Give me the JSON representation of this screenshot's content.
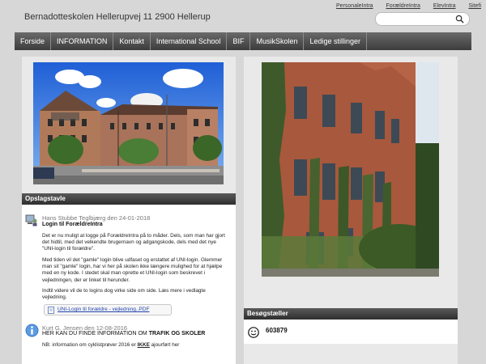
{
  "header": {
    "title": "Bernadotteskolen Hellerupvej 11 2900 Hellerup",
    "links": [
      "PersonaleIntra",
      "ForældreIntra",
      "ElevIntra",
      "Sitefi"
    ],
    "search_placeholder": ""
  },
  "nav": {
    "items": [
      "Forside",
      "INFORMATION",
      "Kontakt",
      "International School",
      "BIF",
      "MusikSkolen",
      "Ledige stillinger"
    ]
  },
  "board": {
    "title": "Opslagstavle",
    "post1": {
      "meta": "Hans Stubbe Teglbjærg den 24-01-2018",
      "title": "Login til ForældreIntra",
      "p1": "Det er nu muligt at logge på ForældreIntra på to måder. Dels, som man har gjort det hidtil, med det velkendte brugernavn og adgangskode, dels med det nye \"UNI-login til forældre\".",
      "p2": "Med tiden vil det \"gamle\" login blive udfaset og erstattet af UNI-login. Glemmer man sit \"gamle\" login, har vi her på skolen ikke længere mulighed for at hjælpe med en ny kode. I stedet skal man oprette et UNI-login som beskrevet i vejledningen, der er linket til herunder.",
      "p3": "Indtil videre vil de to logins dog virke side om side. Læs mere i vedlagte vejledning.",
      "attachment": "UNI-Login til forældre - vejledning..PDF"
    },
    "post2": {
      "meta": "Kurt G. Jensen den 12-08-2016",
      "title_prefix": "HER KAN DU FINDE INFORMATION OM ",
      "title_bold": "TRAFIK OG SKOLER",
      "line_prefix": "NB: information om cyklistprøver 2016 er ",
      "line_bold": "IKKE",
      "line_suffix": " ajourført her"
    }
  },
  "counter": {
    "title": "Besøgstæller",
    "value": "603879"
  }
}
